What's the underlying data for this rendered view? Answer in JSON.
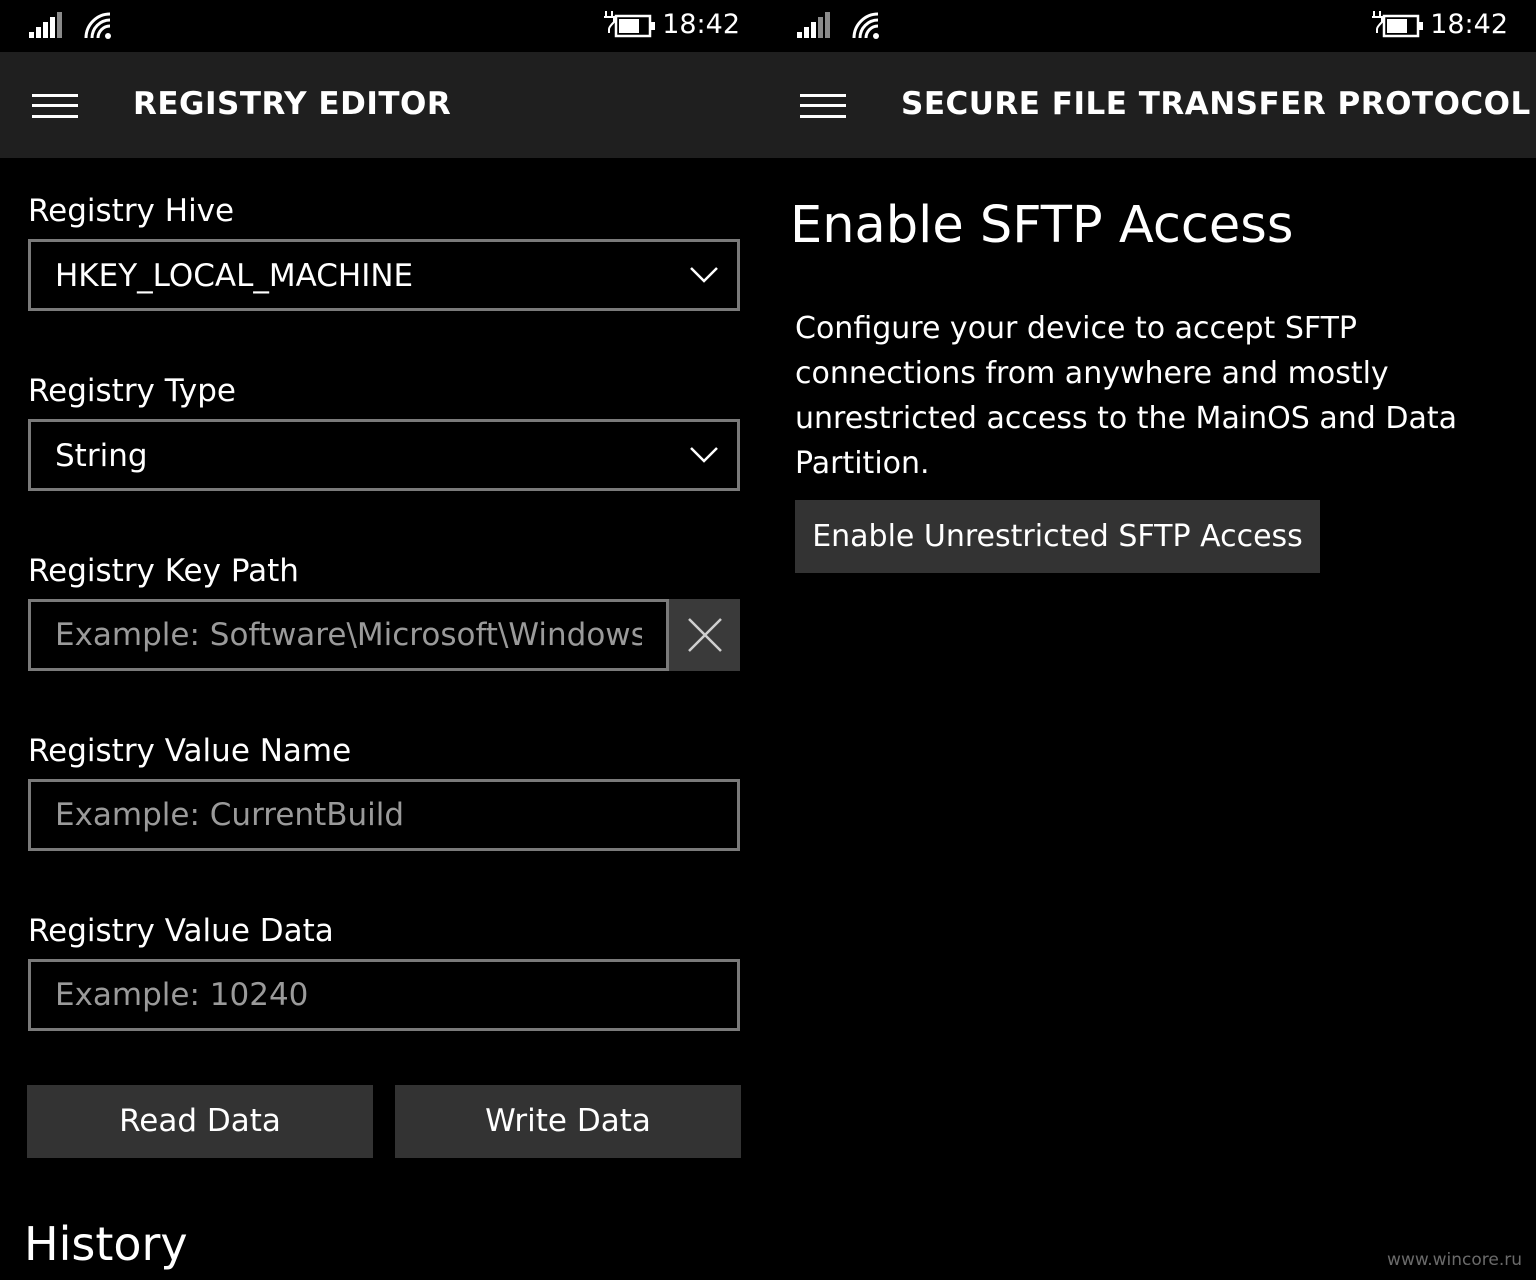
{
  "left_screen": {
    "status_bar": {
      "time": "18:42"
    },
    "title": "REGISTRY EDITOR",
    "hive": {
      "label": "Registry Hive",
      "selected": "HKEY_LOCAL_MACHINE"
    },
    "type": {
      "label": "Registry Type",
      "selected": "String"
    },
    "key_path": {
      "label": "Registry Key Path",
      "placeholder": "Example: Software\\Microsoft\\Windows NT\\CurrentVersion",
      "value": ""
    },
    "value_name": {
      "label": "Registry Value Name",
      "placeholder": "Example: CurrentBuild",
      "value": ""
    },
    "value_data": {
      "label": "Registry Value Data",
      "placeholder": "Example: 10240",
      "value": ""
    },
    "buttons": {
      "read": "Read Data",
      "write": "Write Data"
    },
    "history_heading": "History"
  },
  "right_screen": {
    "status_bar": {
      "time": "18:42"
    },
    "title": "SECURE FILE TRANSFER PROTOCOL",
    "heading": "Enable SFTP Access",
    "description": "Configure your device to accept SFTP connections from anywhere and mostly unrestricted access to the MainOS and Data Partition.",
    "button": "Enable Unrestricted SFTP Access"
  },
  "watermark": "www.wincore.ru",
  "icons": [
    "signal-icon",
    "wifi-icon",
    "battery-icon",
    "hamburger-icon",
    "chevron-down-icon",
    "close-icon"
  ],
  "colors": {
    "background": "#000000",
    "app_bar": "#1f1f1f",
    "button": "#333333",
    "border": "#7a7a7a",
    "placeholder": "#9a9a9a"
  }
}
